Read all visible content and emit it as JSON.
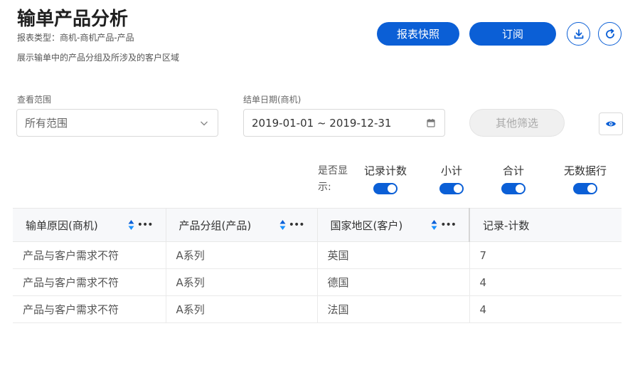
{
  "header": {
    "title": "输单产品分析",
    "subtitle": "报表类型：商机-商机产品-产品",
    "description": "展示输单中的产品分组及所涉及的客户区域"
  },
  "actions": {
    "snapshot_label": "报表快照",
    "subscribe_label": "订阅",
    "download_icon": "download-icon",
    "refresh_icon": "refresh-icon"
  },
  "filters": {
    "scope_label": "查看范围",
    "scope_value": "所有范围",
    "date_label": "结单日期(商机)",
    "date_value": "2019-01-01 ~ 2019-12-31",
    "other_label": "其他筛选"
  },
  "display_options": {
    "label_line1": "是否显",
    "label_line2": "示:",
    "toggles": [
      {
        "label": "记录计数",
        "on": true
      },
      {
        "label": "小计",
        "on": true
      },
      {
        "label": "合计",
        "on": true
      },
      {
        "label": "无数据行",
        "on": true
      }
    ]
  },
  "table": {
    "columns": [
      "输单原因(商机)",
      "产品分组(产品)",
      "国家地区(客户)",
      "记录-计数"
    ],
    "rows": [
      [
        "产品与客户需求不符",
        "A系列",
        "英国",
        "7"
      ],
      [
        "产品与客户需求不符",
        "A系列",
        "德国",
        "4"
      ],
      [
        "产品与客户需求不符",
        "A系列",
        "法国",
        "4"
      ]
    ]
  },
  "colors": {
    "primary": "#0b5fd6",
    "sort_up": "#0b5fd6",
    "sort_down": "#1890ff"
  }
}
